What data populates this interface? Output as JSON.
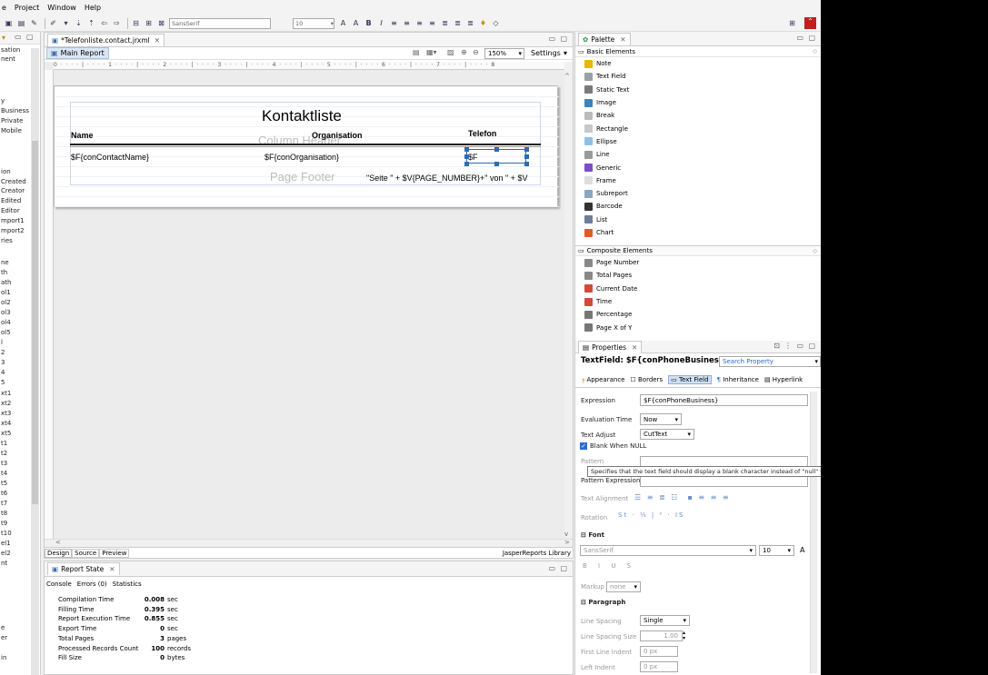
{
  "menu": [
    "e",
    "Project",
    "Window",
    "Help"
  ],
  "toolbar": {
    "font": "SansSerif",
    "font_size": "10"
  },
  "left_panel": {
    "items": [
      "sation",
      "nent",
      "y",
      "Business",
      "Private",
      "Mobile",
      "ion",
      "Created",
      "Creator",
      "Edited",
      "Editor",
      "mport1",
      "mport2",
      "ries",
      "ne",
      "th",
      "ath",
      "ol1",
      "ol2",
      "ol3",
      "ol4",
      "ol5",
      "l",
      "2",
      "3",
      "4",
      "5",
      "xt1",
      "xt2",
      "xt3",
      "xt4",
      "xt5",
      "t1",
      "t2",
      "t3",
      "t4",
      "t5",
      "t6",
      "t7",
      "t8",
      "t9",
      "t10",
      "el1",
      "el2",
      "nt",
      "e",
      "er",
      "in"
    ]
  },
  "editor": {
    "tab": "*Telefonliste.contact.jrxml",
    "subtab": "Main Report",
    "zoom": "150%",
    "settings": "Settings",
    "report": {
      "title": "Kontaktliste",
      "column_header_band": "Column Header",
      "page_footer_band": "Page Footer",
      "headers": [
        "Name",
        "Organisation",
        "Telefon"
      ],
      "fields": [
        "$F{conContactName}",
        "$F{conOrganisation}",
        "$F"
      ],
      "footer_expr": "\"Seite \" + $V{PAGE_NUMBER}+\" von \" + $V"
    },
    "bottom_tabs": [
      "Design",
      "Source",
      "Preview"
    ],
    "library": "JasperReports Library"
  },
  "report_state": {
    "tab": "Report State",
    "subtabs": [
      "Console",
      "Errors (0)",
      "Statistics"
    ],
    "rows": [
      {
        "label": "Compilation Time",
        "value": "0.008",
        "unit": "sec"
      },
      {
        "label": "Filling Time",
        "value": "0.395",
        "unit": "sec"
      },
      {
        "label": "Report Execution Time",
        "value": "0.855",
        "unit": "sec"
      },
      {
        "label": "Export Time",
        "value": "0",
        "unit": "sec"
      },
      {
        "label": "Total Pages",
        "value": "3",
        "unit": "pages"
      },
      {
        "label": "Processed Records Count",
        "value": "100",
        "unit": "records"
      },
      {
        "label": "Fill Size",
        "value": "0",
        "unit": "bytes"
      }
    ]
  },
  "palette": {
    "tab": "Palette",
    "basic": "Basic Elements",
    "basic_items": [
      {
        "label": "Note",
        "color": "#e6b800"
      },
      {
        "label": "Text Field",
        "color": "#9aa0a6"
      },
      {
        "label": "Static Text",
        "color": "#7a7a7a"
      },
      {
        "label": "Image",
        "color": "#3b82c4"
      },
      {
        "label": "Break",
        "color": "#bbbbbb"
      },
      {
        "label": "Rectangle",
        "color": "#c8c8c8"
      },
      {
        "label": "Ellipse",
        "color": "#8fc1e8"
      },
      {
        "label": "Line",
        "color": "#999999"
      },
      {
        "label": "Generic",
        "color": "#7b4fc9"
      },
      {
        "label": "Frame",
        "color": "#dddddd"
      },
      {
        "label": "Subreport",
        "color": "#8aa6c1"
      },
      {
        "label": "Barcode",
        "color": "#333333"
      },
      {
        "label": "List",
        "color": "#6b7d99"
      },
      {
        "label": "Chart",
        "color": "#e05a2b"
      }
    ],
    "composite": "Composite Elements",
    "composite_items": [
      {
        "label": "Page Number",
        "color": "#888888"
      },
      {
        "label": "Total Pages",
        "color": "#888888"
      },
      {
        "label": "Current Date",
        "color": "#d04a3a"
      },
      {
        "label": "Time",
        "color": "#d04a3a"
      },
      {
        "label": "Percentage",
        "color": "#777777"
      },
      {
        "label": "Page X of Y",
        "color": "#777777"
      }
    ]
  },
  "properties": {
    "tab": "Properties",
    "title": "TextField: $F{conPhoneBusiness}",
    "search": "Search Property",
    "tabs": [
      "Appearance",
      "Borders",
      "Text Field",
      "Inheritance",
      "Hyperlink"
    ],
    "expression_label": "Expression",
    "expression": "$F{conPhoneBusiness}",
    "eval_label": "Evaluation Time",
    "eval": "Now",
    "adjust_label": "Text Adjust",
    "adjust": "CutText",
    "blank_label": "Blank When NULL",
    "pattern_label": "Pattern",
    "pattern_expr_label": "Pattern Expression",
    "align_label": "Text Alignment",
    "rotation_label": "Rotation",
    "font_section": "Font",
    "font": "SansSerif",
    "font_size": "10",
    "markup_label": "Markup",
    "markup": "none",
    "paragraph_section": "Paragraph",
    "line_spacing_label": "Line Spacing",
    "line_spacing": "Single",
    "line_spacing_size_label": "Line Spacing Size",
    "line_spacing_size": "1.00",
    "first_indent_label": "First Line Indent",
    "first_indent": "0 px",
    "left_indent_label": "Left Indent",
    "left_indent": "0 px"
  },
  "tooltip": "Specifies that the text field should display a blank character instead of \"null\" when the text field expression evaluates to null."
}
